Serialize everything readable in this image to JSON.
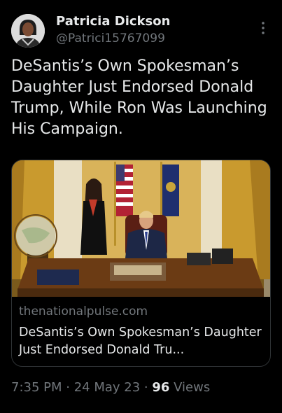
{
  "author": {
    "name": "Patricia Dickson",
    "handle": "@Patrici15767099"
  },
  "tweet": {
    "text": "DeSantis’s Own Spokesman’s Daughter Just Endorsed Donald Trump, While Ron Was Launching His Campaign."
  },
  "link_card": {
    "domain": "thenationalpulse.com",
    "title": "DeSantis’s Own Spokesman’s Daughter Just Endorsed Donald Tru..."
  },
  "meta": {
    "time": "7:35 PM",
    "separator": " · ",
    "date": "24 May 23",
    "views_count": "96",
    "views_label": " Views"
  },
  "icons": {
    "more": "more-vertical-icon"
  },
  "colors": {
    "background": "#000000",
    "primary_text": "#e7e9ea",
    "secondary_text": "#71767b",
    "border": "#2f3336"
  }
}
